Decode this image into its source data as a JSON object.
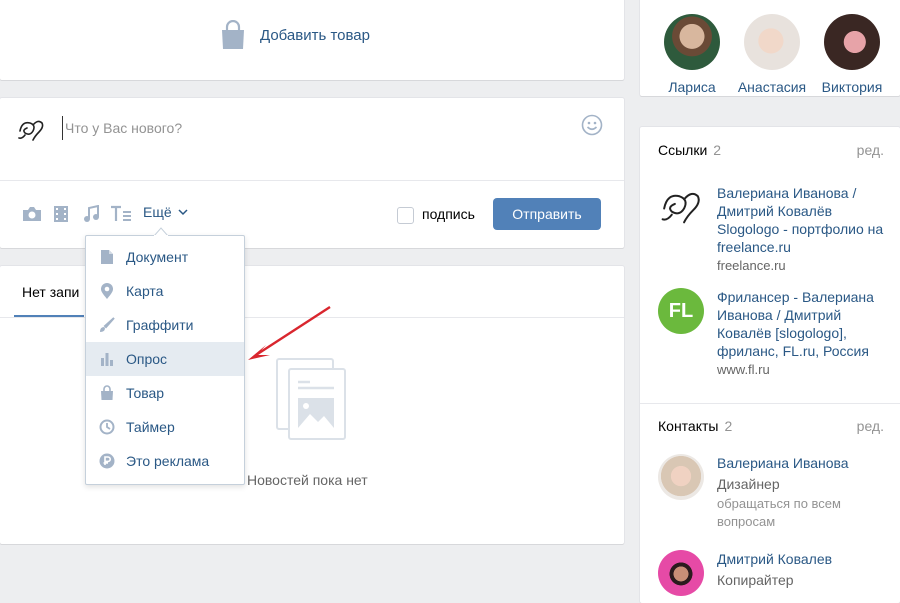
{
  "add_product": {
    "label": "Добавить товар",
    "icon": "shopping-bag-icon"
  },
  "post": {
    "placeholder": "Что у Вас нового?",
    "more_label": "Ещё",
    "sign_label": "подпись",
    "send_label": "Отправить"
  },
  "wall": {
    "tab_label": "Нет запи",
    "empty_text": "Новостей пока нет"
  },
  "dropdown": {
    "items": [
      {
        "label": "Документ",
        "icon": "document-icon"
      },
      {
        "label": "Карта",
        "icon": "map-pin-icon"
      },
      {
        "label": "Граффити",
        "icon": "brush-icon"
      },
      {
        "label": "Опрос",
        "icon": "poll-icon",
        "highlighted": true
      },
      {
        "label": "Товар",
        "icon": "shopping-bag-icon"
      },
      {
        "label": "Таймер",
        "icon": "clock-icon"
      },
      {
        "label": "Это реклама",
        "icon": "ad-badge-icon"
      }
    ]
  },
  "friends": [
    {
      "name": "Лариса"
    },
    {
      "name": "Анастасия"
    },
    {
      "name": "Виктория"
    }
  ],
  "links": {
    "title": "Ссылки",
    "count": "2",
    "edit": "ред.",
    "items": [
      {
        "title": "Валериана Иванова / Дмитрий Ковалёв Slogologo - портфолио на freelance.ru",
        "domain": "freelance.ru"
      },
      {
        "title": "Фрилансер - Валериана Иванова / Дмитрий Ковалёв [slogologo], фриланс, FL.ru, Россия",
        "domain": "www.fl.ru",
        "logo_text": "FL"
      }
    ]
  },
  "contacts": {
    "title": "Контакты",
    "count": "2",
    "edit": "ред.",
    "items": [
      {
        "name": "Валериана Иванова",
        "role": "Дизайнер",
        "note": "обращаться по всем вопросам"
      },
      {
        "name": "Дмитрий Ковалев",
        "role": "Копирайтер"
      }
    ]
  },
  "colors": {
    "accent": "#5181b8",
    "link": "#2a5885",
    "background": "#edeef0",
    "fl_green": "#6bb93d",
    "arrow_red": "#d9262e"
  }
}
